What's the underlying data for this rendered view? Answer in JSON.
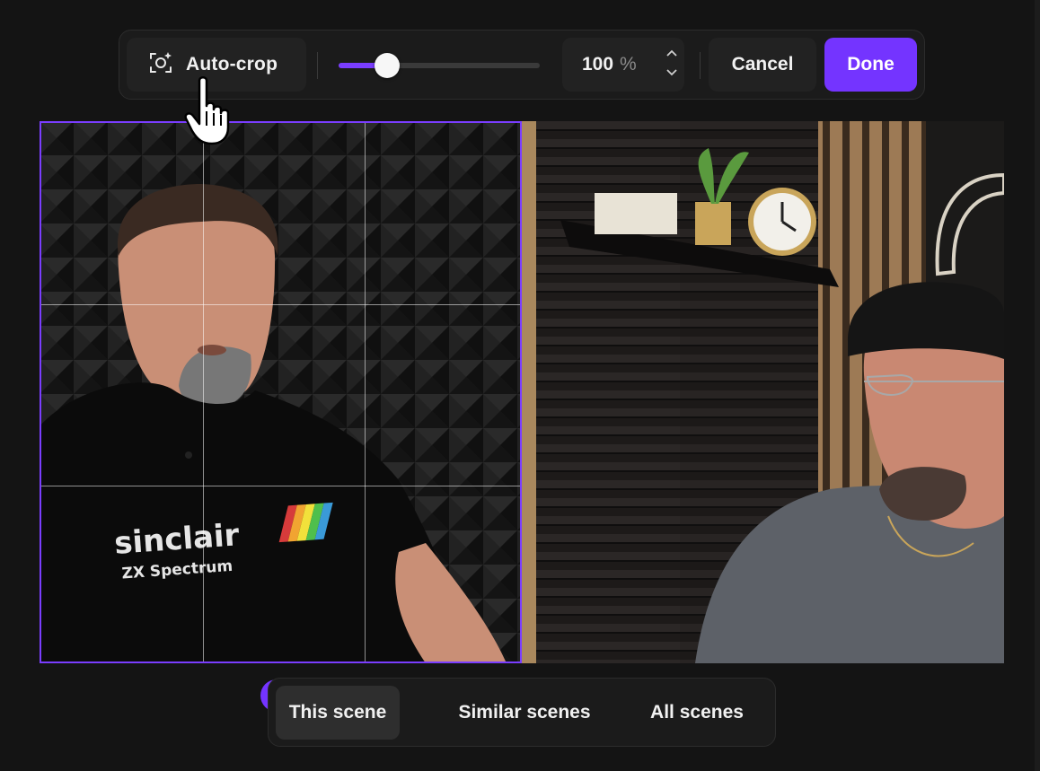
{
  "toolbar": {
    "autocrop_label": "Auto-crop",
    "zoom": {
      "slider_fraction": 0.24,
      "value": "100",
      "unit": "%"
    },
    "cancel_label": "Cancel",
    "done_label": "Done"
  },
  "scene_selector": {
    "options": [
      "This scene",
      "Similar scenes",
      "All scenes"
    ],
    "active": "This scene"
  },
  "preview": {
    "shirt_text_line1": "sinclair",
    "shirt_text_line2": "ZX Spectrum"
  },
  "colors": {
    "accent": "#7434ff",
    "background": "#141414",
    "panel": "#1b1b1b"
  },
  "icons": [
    "auto-crop-icon",
    "chevron-up-icon",
    "chevron-down-icon",
    "hand-pointer-cursor-icon"
  ]
}
